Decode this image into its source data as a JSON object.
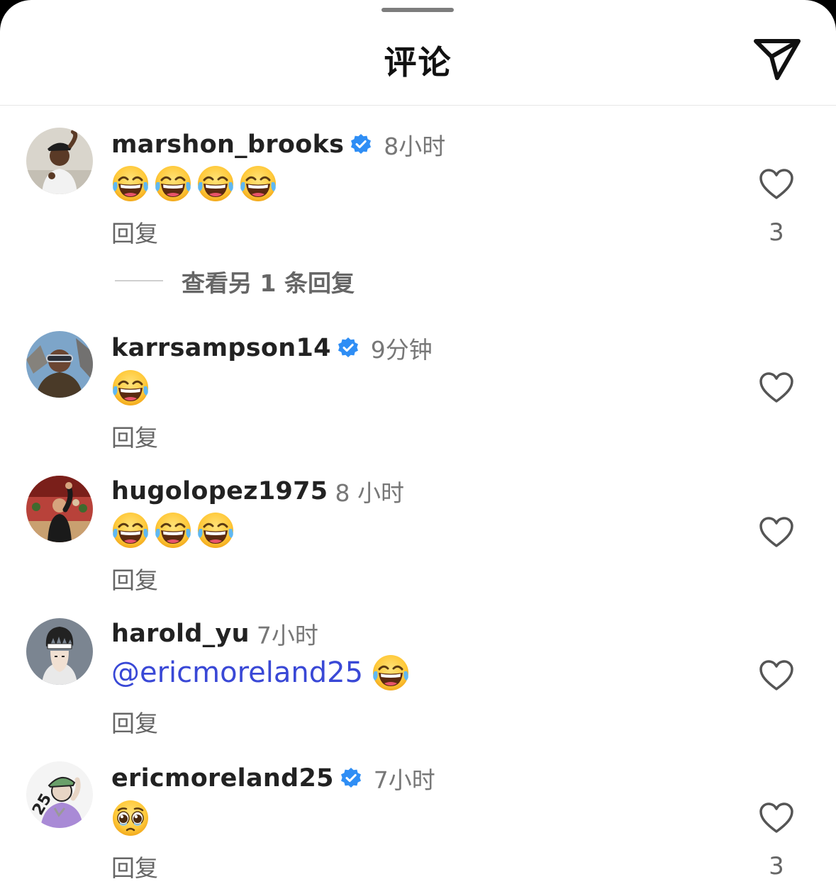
{
  "header": {
    "title": "评论",
    "share_icon": "send-icon"
  },
  "reply_label": "回复",
  "comments": [
    {
      "username": "marshon_brooks",
      "verified": true,
      "time": "8小时",
      "emoji_count": 4,
      "emoji": "laugh-cry",
      "likes": "3",
      "view_replies": "查看另 1 条回复"
    },
    {
      "username": "karrsampson14",
      "verified": true,
      "time": "9分钟",
      "emoji_count": 1,
      "emoji": "laugh-cry",
      "likes": ""
    },
    {
      "username": "hugolopez1975",
      "verified": false,
      "time": "8 小时",
      "emoji_count": 3,
      "emoji": "laugh-cry",
      "likes": ""
    },
    {
      "username": "harold_yu",
      "verified": false,
      "time": "7小时",
      "mention": "@ericmoreland25",
      "emoji_count": 1,
      "emoji": "laugh-cry",
      "likes": ""
    },
    {
      "username": "ericmoreland25",
      "verified": true,
      "time": "7小时",
      "emoji_count": 1,
      "emoji": "pleading-face",
      "likes": "3"
    }
  ],
  "colors": {
    "mention": "#3948d6",
    "verified": "#2f8ef5",
    "muted_text": "#777777"
  }
}
